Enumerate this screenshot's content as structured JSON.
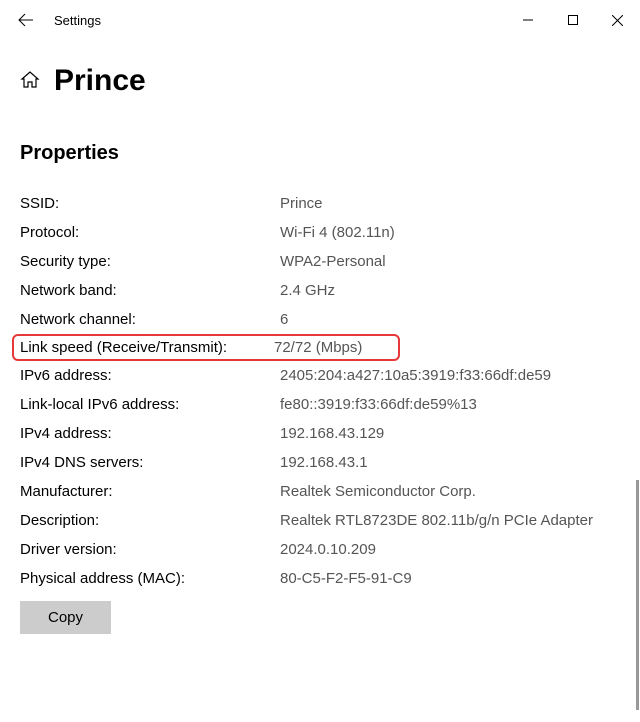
{
  "window": {
    "title": "Settings"
  },
  "page": {
    "title": "Prince"
  },
  "section": {
    "title": "Properties"
  },
  "props": {
    "ssid": {
      "label": "SSID:",
      "value": "Prince"
    },
    "protocol": {
      "label": "Protocol:",
      "value": "Wi-Fi 4 (802.11n)"
    },
    "security": {
      "label": "Security type:",
      "value": "WPA2-Personal"
    },
    "band": {
      "label": "Network band:",
      "value": "2.4 GHz"
    },
    "channel": {
      "label": "Network channel:",
      "value": "6"
    },
    "linkspeed": {
      "label": "Link speed (Receive/Transmit):",
      "value": "72/72 (Mbps)"
    },
    "ipv6": {
      "label": "IPv6 address:",
      "value": "2405:204:a427:10a5:3919:f33:66df:de59"
    },
    "linklocal": {
      "label": "Link-local IPv6 address:",
      "value": "fe80::3919:f33:66df:de59%13"
    },
    "ipv4": {
      "label": "IPv4 address:",
      "value": "192.168.43.129"
    },
    "dns": {
      "label": "IPv4 DNS servers:",
      "value": "192.168.43.1"
    },
    "manufacturer": {
      "label": "Manufacturer:",
      "value": "Realtek Semiconductor Corp."
    },
    "description": {
      "label": "Description:",
      "value": "Realtek RTL8723DE 802.11b/g/n PCIe Adapter"
    },
    "driver": {
      "label": "Driver version:",
      "value": "2024.0.10.209"
    },
    "mac": {
      "label": "Physical address (MAC):",
      "value": "80-C5-F2-F5-91-C9"
    }
  },
  "buttons": {
    "copy": "Copy"
  }
}
